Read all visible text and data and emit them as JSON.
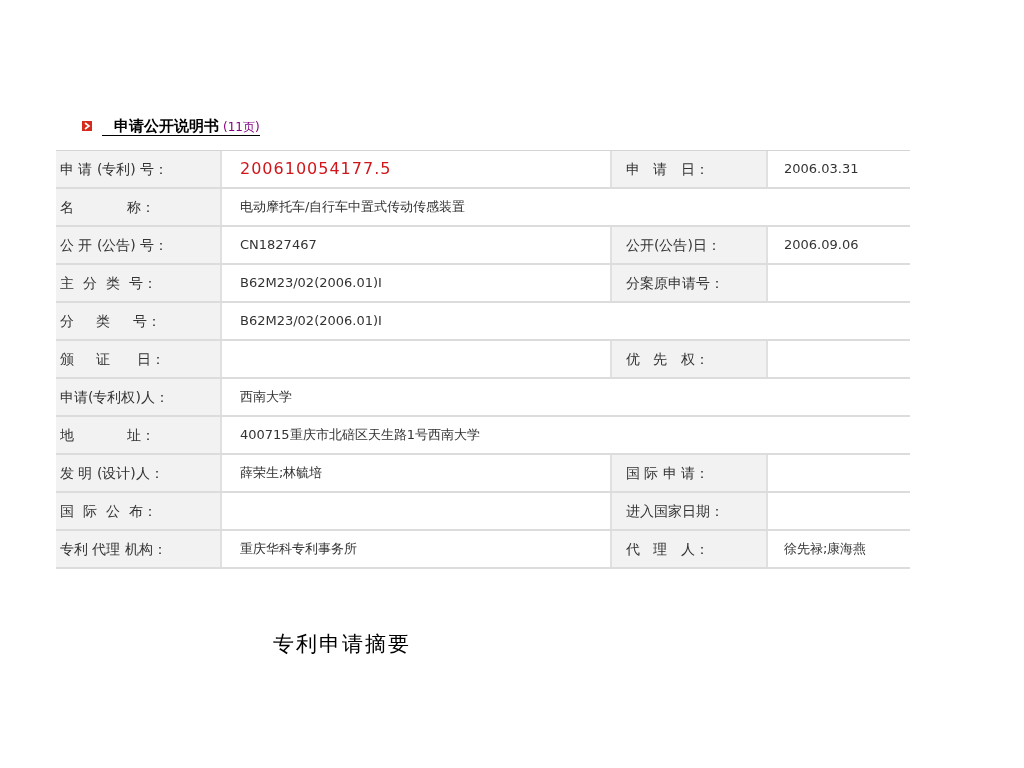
{
  "section": {
    "title": "申请公开说明书",
    "pages_link": "(11页)"
  },
  "rows": [
    {
      "label": "申 请 (专利) 号：",
      "value": "200610054177.5",
      "emphasis": true,
      "label2": "申   请   日：",
      "value2": "2006.03.31"
    },
    {
      "label": "名            称：",
      "value": "电动摩托车/自行车中置式传动传感装置",
      "emphasis": false
    },
    {
      "label": "公 开 (公告) 号：",
      "value": "CN1827467",
      "emphasis": false,
      "label2": "公开(公告)日：",
      "value2": "2006.09.06"
    },
    {
      "label": "主  分  类  号：",
      "value": "B62M23/02(2006.01)I",
      "emphasis": false,
      "label2": "分案原申请号："
    },
    {
      "label": "分     类     号：",
      "value": "B62M23/02(2006.01)I",
      "emphasis": false
    },
    {
      "label": "颁     证      日：",
      "label2": "优   先   权："
    },
    {
      "label": "申请(专利权)人：",
      "value": "西南大学",
      "emphasis": false
    },
    {
      "label": "地            址：",
      "value": "400715重庆市北碚区天生路1号西南大学",
      "emphasis": false
    },
    {
      "label": "发 明 (设计)人：",
      "value": "薛荣生;林毓培",
      "emphasis": false,
      "label2": "国 际 申 请："
    },
    {
      "label": "国  际  公  布：",
      "label2": "进入国家日期："
    },
    {
      "label": "专利 代理 机构：",
      "value": "重庆华科专利事务所",
      "emphasis": false,
      "label2": "代   理   人：",
      "value2": "徐先禄;康海燕"
    }
  ],
  "abstract_heading": "专利申请摘要"
}
